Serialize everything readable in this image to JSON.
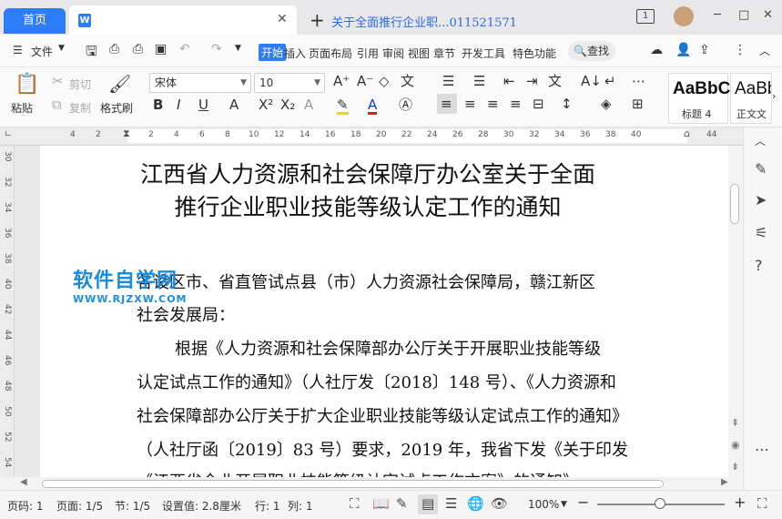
{
  "tabs": {
    "home_label": "首页",
    "doc_label": "关于全面推行企业职...011521571",
    "close_glyph": "✕",
    "new_glyph": "+"
  },
  "window": {
    "page_count_icon": "1",
    "minimize": "─",
    "maximize": "□",
    "close": "✕"
  },
  "menu": {
    "file": "文件",
    "items": [
      "开始",
      "插入",
      "页面布局",
      "引用",
      "审阅",
      "视图",
      "章节",
      "开发工具",
      "特色功能"
    ],
    "active_index": 0,
    "search": "查找"
  },
  "ribbon": {
    "paste": "粘贴",
    "cut": "剪切",
    "copy": "复制",
    "format_painter": "格式刷",
    "font_name": "宋体",
    "font_size": "10",
    "styles": [
      {
        "sample": "AaBbC",
        "name": "标题 4"
      },
      {
        "sample": "AaBb",
        "name": "正文文"
      }
    ]
  },
  "ruler": {
    "ticks": [
      "4",
      "2",
      "2",
      "4",
      "6",
      "8",
      "10",
      "12",
      "14",
      "16",
      "18",
      "20",
      "22",
      "24",
      "26",
      "28",
      "30",
      "32",
      "34",
      "36",
      "38",
      "40",
      "44"
    ],
    "vticks": [
      "30",
      "32",
      "34",
      "36",
      "38",
      "40",
      "42",
      "44",
      "46",
      "48",
      "50",
      "52",
      "54"
    ]
  },
  "document": {
    "title_line1": "江西省人力资源和社会保障厅办公室关于全面",
    "title_line2": "推行企业职业技能等级认定工作的通知",
    "para1_line1": "各设区市、省直管试点县（市）人力资源社会保障局，赣江新区",
    "para1_line2": "社会发展局：",
    "para2_line1": "根据《人力资源和社会保障部办公厅关于开展职业技能等级",
    "para2_line2": "认定试点工作的通知》（人社厅发〔2018〕148 号）、《人力资源和",
    "para2_line3": "社会保障部办公厅关于扩大企业职业技能等级认定试点工作的通知》",
    "para2_line4": "（人社厅函〔2019〕83 号）要求，2019 年，我省下发《关于印发",
    "para2_line5": "《江西省企业开展职业技能等级认定试点工作方案》的通知》"
  },
  "watermark": {
    "line1": "软件自学网",
    "line2": "WWW.RJZXW.COM"
  },
  "status": {
    "page": "页码: 1",
    "pages": "页面: 1/5",
    "section": "节: 1/5",
    "setting": "设置值: 2.8厘米",
    "row": "行: 1",
    "col": "列: 1",
    "zoom": "100%",
    "zoom_level_percent": 45
  },
  "colors": {
    "accent": "#2e7cf6",
    "watermark": "#1a8ce0"
  }
}
